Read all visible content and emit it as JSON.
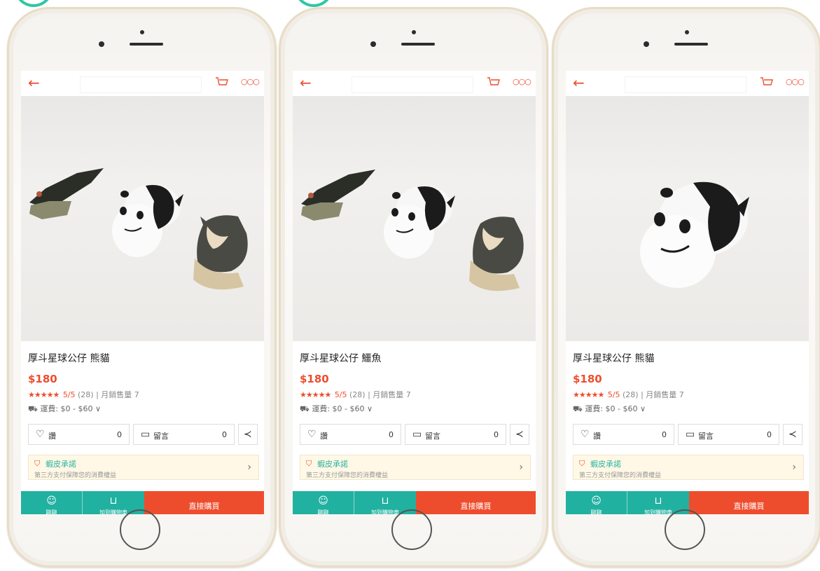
{
  "colors": {
    "accent": "#ee4d2d",
    "teal": "#21b1a0",
    "guarantee_title": "#2bb3a0"
  },
  "phones": [
    {
      "product_title": "厚斗星球公仔 熊貓",
      "price": "$180",
      "stars": "★★★★★",
      "rating": "5/5",
      "review_count": "(28)",
      "sales": "| 月銷售量 7",
      "shipping": "運費: $0 - $60 ∨",
      "like_label": "讚",
      "like_count": "0",
      "comment_label": "留言",
      "comment_count": "0",
      "guarantee_title": "蝦皮承諾",
      "guarantee_sub": "第三方支付保障您的消費權益",
      "chat_label": "聊聊",
      "cart_label": "加到購物車",
      "buy_label": "直接購買",
      "photo_content": "crocodile, panda, dog"
    },
    {
      "product_title": "厚斗星球公仔 鱷魚",
      "price": "$180",
      "stars": "★★★★★",
      "rating": "5/5",
      "review_count": "(28)",
      "sales": "| 月銷售量 7",
      "shipping": "運費: $0 - $60 ∨",
      "like_label": "讚",
      "like_count": "0",
      "comment_label": "留言",
      "comment_count": "0",
      "guarantee_title": "蝦皮承諾",
      "guarantee_sub": "第三方支付保障您的消費權益",
      "chat_label": "聊聊",
      "cart_label": "加到購物車",
      "buy_label": "直接購買",
      "photo_content": "crocodile, panda, dog"
    },
    {
      "product_title": "厚斗星球公仔 熊貓",
      "price": "$180",
      "stars": "★★★★★",
      "rating": "5/5",
      "review_count": "(28)",
      "sales": "| 月銷售量 7",
      "shipping": "運費: $0 - $60 ∨",
      "like_label": "讚",
      "like_count": "0",
      "comment_label": "留言",
      "comment_count": "0",
      "guarantee_title": "蝦皮承諾",
      "guarantee_sub": "第三方支付保障您的消費權益",
      "chat_label": "聊聊",
      "cart_label": "加到購物車",
      "buy_label": "直接購買",
      "photo_content": "panda"
    }
  ],
  "icons": {
    "back": "back-arrow-icon",
    "cart": "cart-icon",
    "more": "more-icon",
    "heart": "heart-icon",
    "comment": "comment-icon",
    "share": "share-icon",
    "shield": "shield-icon",
    "chevron": "chevron-right-icon",
    "chat": "chat-icon",
    "add_to_cart": "add-to-cart-icon"
  }
}
